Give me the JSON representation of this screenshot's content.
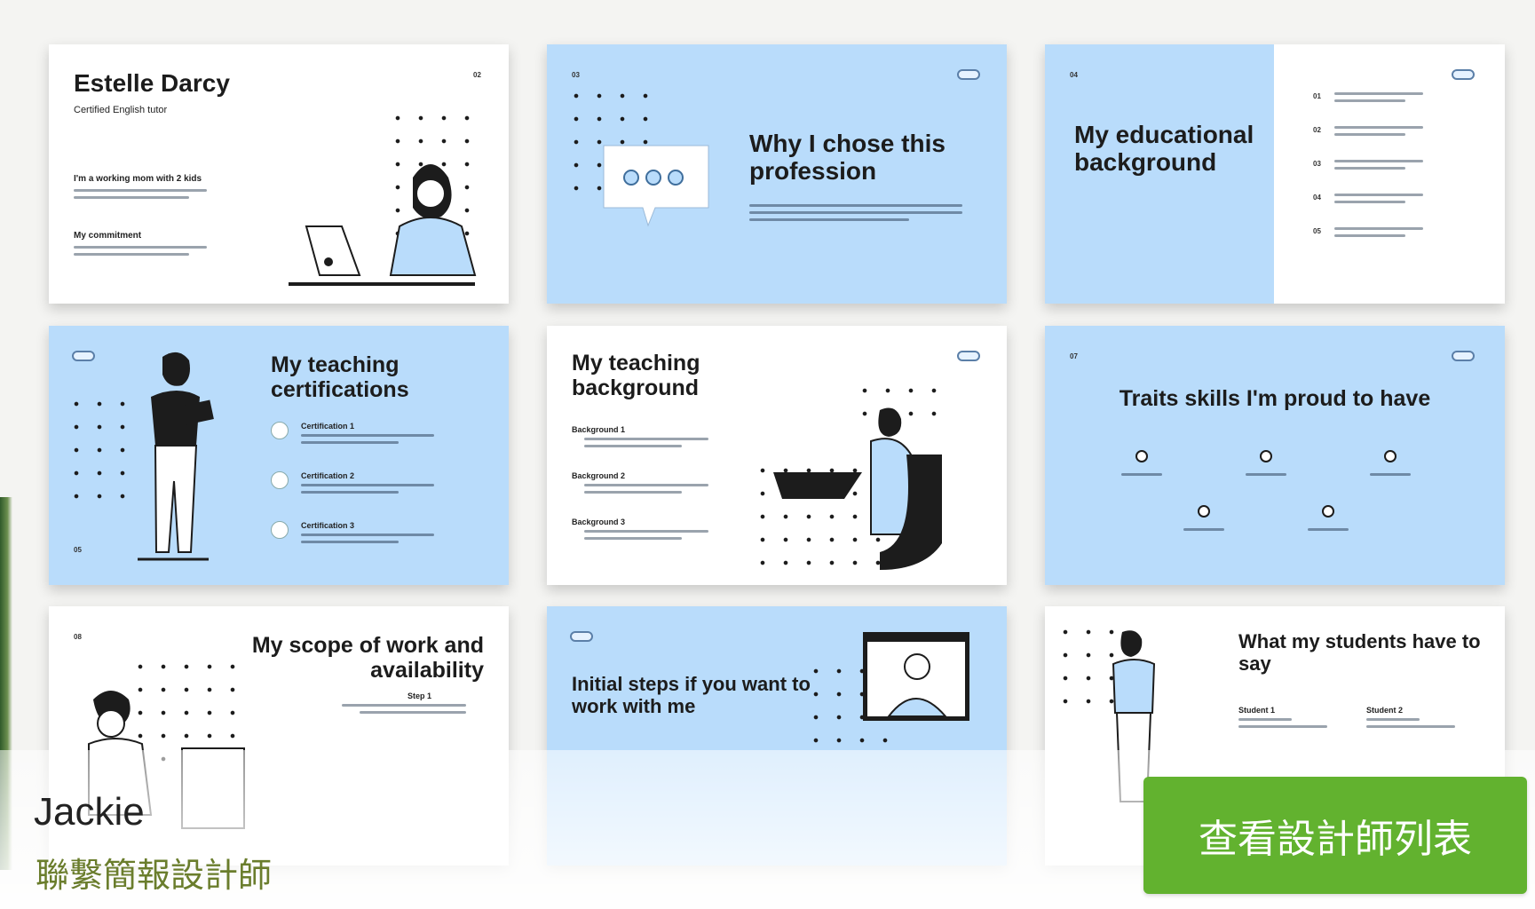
{
  "designer": {
    "name": "Jackie",
    "subtitle": "聯繫簡報設計師",
    "cta_label": "查看設計師列表"
  },
  "slides": {
    "s1": {
      "title": "Estelle Darcy",
      "subtitle": "Certified English tutor",
      "page": "02",
      "heading1": "I'm a working mom with 2 kids",
      "heading2": "My commitment"
    },
    "s2": {
      "title": "Why I chose this profession",
      "page": "03"
    },
    "s3": {
      "title": "My educational background",
      "page": "04",
      "items": [
        "01",
        "02",
        "03",
        "04",
        "05"
      ]
    },
    "s4": {
      "title": "My teaching certifications",
      "page": "05",
      "items": [
        "Certification 1",
        "Certification 2",
        "Certification 3"
      ]
    },
    "s5": {
      "title": "My teaching background",
      "items": [
        "Background 1",
        "Background 2",
        "Background 3"
      ]
    },
    "s6": {
      "title": "Traits skills I'm proud to have",
      "page": "07"
    },
    "s7": {
      "title": "My scope of work and availability",
      "page": "08",
      "step": "Step 1"
    },
    "s8": {
      "title": "Initial steps if you want to work with me"
    },
    "s9": {
      "title": "What my students have to say",
      "students": [
        "Student 1",
        "Student 2"
      ]
    }
  },
  "colors": {
    "slide_blue": "#b9dcfb",
    "cta_green": "#62b22f",
    "subtitle_olive": "#6a7d2c"
  }
}
